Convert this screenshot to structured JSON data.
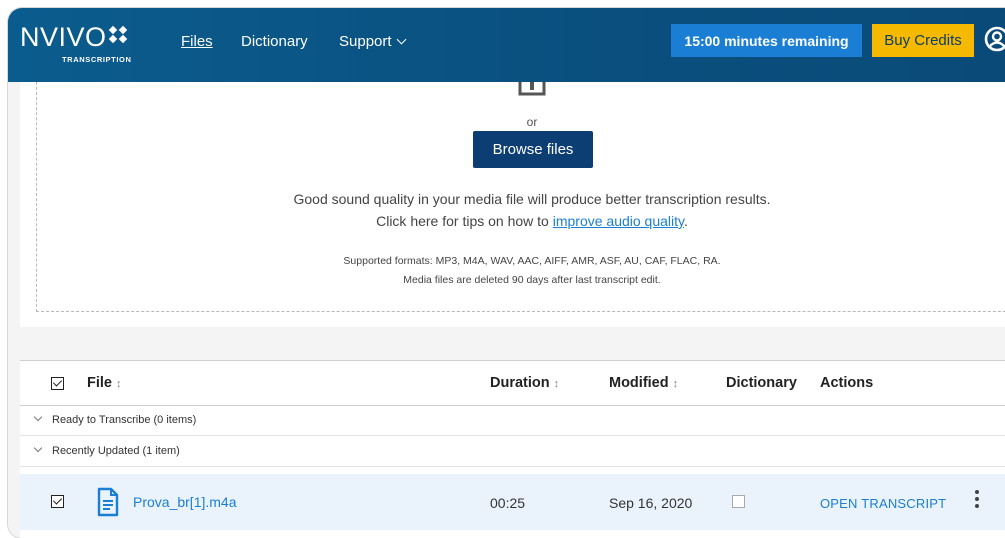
{
  "header": {
    "logo": "NVIVO",
    "logo_sub": "TRANSCRIPTION",
    "nav": {
      "files": "Files",
      "dictionary": "Dictionary",
      "support": "Support"
    },
    "time_remaining": "15:00 minutes remaining",
    "buy_credits": "Buy Credits"
  },
  "upload": {
    "or_text": "or",
    "browse_label": "Browse files",
    "tip_line1": "Good sound quality in your media file will produce better transcription results.",
    "tip_line2_prefix": "Click here for tips on how to ",
    "tip_link": "improve audio quality",
    "tip_line2_suffix": ".",
    "formats": "Supported formats: MP3, M4A, WAV, AAC, AIFF, AMR, ASF, AU, CAF, FLAC, RA.",
    "retention": "Media files are deleted 90 days after last transcript edit."
  },
  "table": {
    "columns": {
      "file": "File",
      "duration": "Duration",
      "modified": "Modified",
      "dictionary": "Dictionary",
      "actions": "Actions"
    },
    "sort_glyph": "↕",
    "groups": [
      {
        "label": "Ready to Transcribe (0 items)"
      },
      {
        "label": "Recently Updated (1 item)"
      }
    ],
    "rows": [
      {
        "file": "Prova_br[1].m4a",
        "duration": "00:25",
        "modified": "Sep 16, 2020",
        "dictionary_checked": false,
        "selected": true,
        "action": "OPEN TRANSCRIPT"
      }
    ]
  },
  "icons": [
    "logo-diamonds-icon",
    "chevron-down-icon",
    "user-account-icon",
    "upload-icon",
    "chevron-down-icon",
    "document-icon",
    "kebab-menu-icon",
    "sort-icon"
  ],
  "colors": {
    "header": "#0b5c8e",
    "time_box": "#1a7fd4",
    "buy_button": "#f5b900",
    "browse_button": "#0c3e73",
    "link": "#1a7fd4",
    "selected_row": "#eaf2fb"
  }
}
